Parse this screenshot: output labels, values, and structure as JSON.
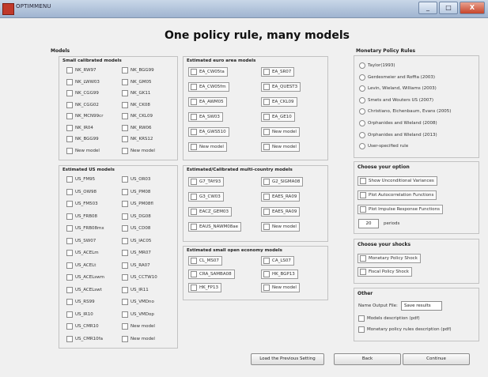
{
  "window": {
    "title": "OPTIMMENU",
    "min": "_",
    "max": "□",
    "close": "X"
  },
  "main_title": "One policy rule, many models",
  "models": {
    "label": "Models",
    "small": {
      "title": "Small calibrated models",
      "col1": [
        "NK_RW97",
        "NK_LWW03",
        "NK_CGG99",
        "NK_CGG02",
        "NK_MCN99cr",
        "NK_IR04",
        "NK_BGG99",
        "New model"
      ],
      "col2": [
        "NK_BGG99",
        "NK_GM05",
        "NK_GK11",
        "NK_CK08",
        "NK_CKL09",
        "NK_RW06",
        "NK_KRS12",
        "New model"
      ]
    },
    "euro": {
      "title": "Estimated euro area models",
      "col1": [
        "EA_CW05ta",
        "EA_CW05fm",
        "EA_AWM05",
        "EA_SW03",
        "EA_GWS510",
        "New model"
      ],
      "col2": [
        "EA_SR07",
        "EA_QUEST3",
        "EA_CKL09",
        "EA_GE10",
        "New model",
        "New model"
      ]
    },
    "us": {
      "title": "Estimated US models",
      "col1": [
        "US_FM95",
        "US_OW98",
        "US_FM503",
        "US_FRB08",
        "US_FRB08mx",
        "US_SW07",
        "US_ACELm",
        "US_ACELt",
        "US_ACELswm",
        "US_ACELswt",
        "US_RS99",
        "US_IR10",
        "US_CMR10",
        "US_CMR10fa"
      ],
      "col2": [
        "US_OR03",
        "US_PM08",
        "US_PM08fl",
        "US_DG08",
        "US_CD08",
        "US_IAC05",
        "US_MR07",
        "US_RA07",
        "US_CCTW10",
        "US_IR11",
        "US_VMDno",
        "US_VMDop",
        "New model",
        "New model"
      ]
    },
    "multi": {
      "title": "Estimated/Calibrated multi-country models",
      "col1": [
        "G7_TAY93",
        "G3_CW03",
        "EACZ_GEM03",
        "EAUS_NAWM08ae"
      ],
      "col2": [
        "G2_SIGMA08",
        "EAES_RA09",
        "EAES_RA09",
        "New model"
      ]
    },
    "open": {
      "title": "Estimated small open economy models",
      "col1": [
        "CL_MS07",
        "CRA_SAMBA08",
        "HK_FP13"
      ],
      "col2": [
        "CA_LS07",
        "HK_BGP13",
        "New model"
      ]
    }
  },
  "policy_rules": {
    "title": "Monetary Policy Rules",
    "items": [
      "Taylor(1993)",
      "Gerdesmeier and Roffia (2003)",
      "Levin, Wieland, Williams (2003)",
      "Smets and Wouters US (2007)",
      "Christiano, Eichenbaum, Evans (2005)",
      "Orphanides and Wieland (2008)",
      "Orphanides and Wieland (2013)",
      "User-specified rule"
    ]
  },
  "options": {
    "title": "Choose your option",
    "items": [
      "Show Unconditional Variances",
      "Plot Autocorrelation Functions",
      "Plot Impulse Response Functions"
    ],
    "periods_value": "20",
    "periods_label": "periods"
  },
  "shocks": {
    "title": "Choose your shocks",
    "items": [
      "Monetary Policy Shock",
      "Fiscal Policy Shock"
    ]
  },
  "other": {
    "title": "Other",
    "name_output_label": "Name Output File:",
    "name_output_value": "Save results",
    "items": [
      "Models description (pdf)",
      "Monetary policy rules description (pdf)"
    ]
  },
  "buttons": {
    "load_previous": "Load the Previous Setting",
    "back": "Back",
    "continue": "Continue"
  }
}
